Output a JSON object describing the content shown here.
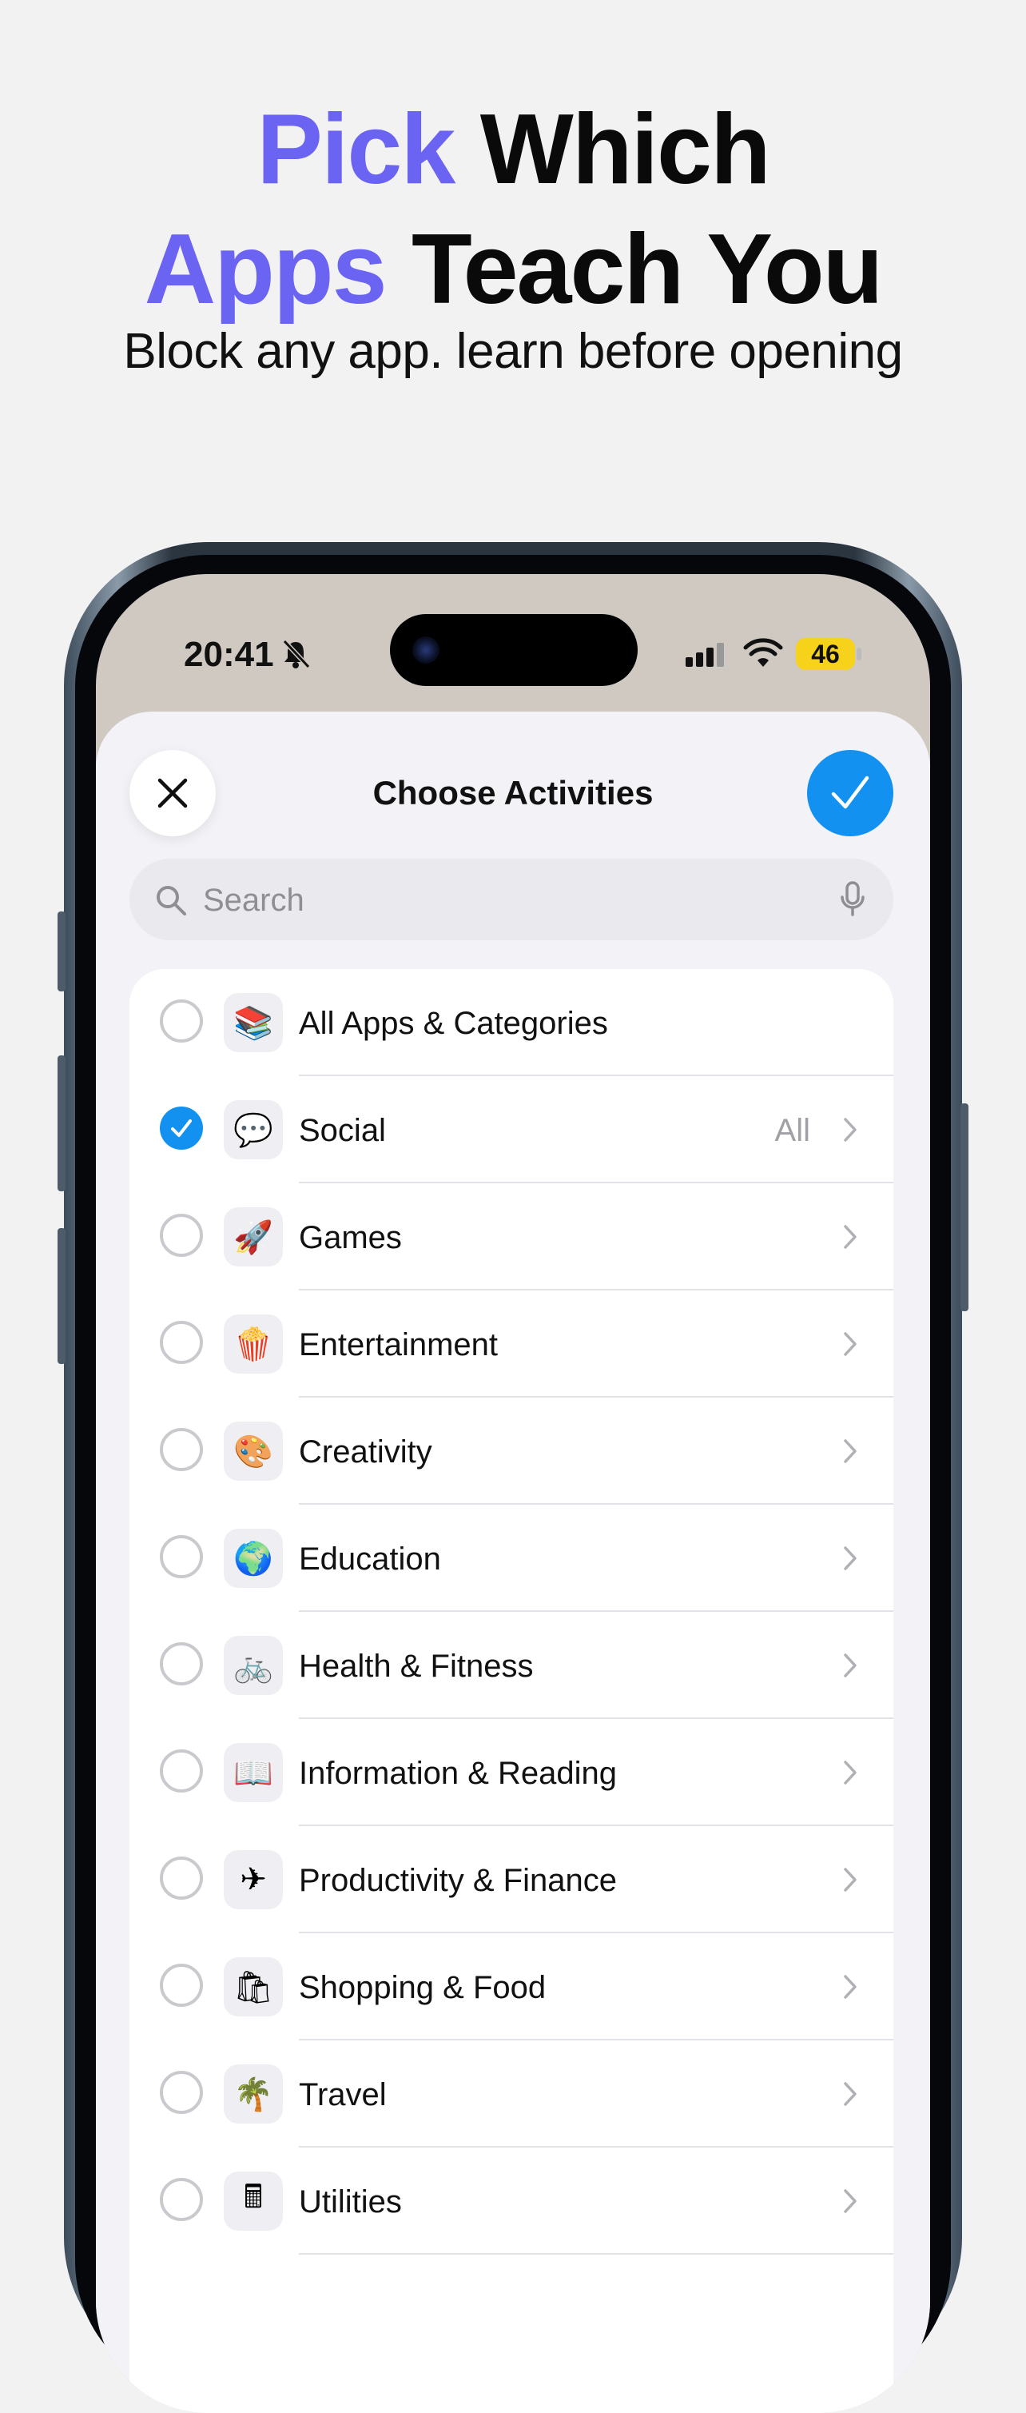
{
  "header": {
    "line1_accent": "Pick",
    "line1_rest": "Which",
    "line2_accent": "Apps",
    "line2_rest": "Teach You",
    "subtitle": "Block any app. learn before opening",
    "accent_color": "#6b63f2"
  },
  "status_bar": {
    "time": "20:41",
    "battery": "46",
    "icons": [
      "bell-slash-icon",
      "cellular-signal-icon",
      "wifi-icon",
      "battery-icon"
    ]
  },
  "sheet": {
    "title": "Choose Activities",
    "close_icon": "close-icon",
    "confirm_icon": "checkmark-icon",
    "confirm_color": "#1291f0",
    "search": {
      "placeholder": "Search",
      "value": ""
    }
  },
  "items": [
    {
      "label": "All Apps & Categories",
      "icon": "stack-icon",
      "checked": false,
      "detail": "",
      "chevron": false
    },
    {
      "label": "Social",
      "icon": "chat-bubbles-icon",
      "checked": true,
      "detail": "All",
      "chevron": true
    },
    {
      "label": "Games",
      "icon": "rocket-icon",
      "checked": false,
      "detail": "",
      "chevron": true
    },
    {
      "label": "Entertainment",
      "icon": "popcorn-icon",
      "checked": false,
      "detail": "",
      "chevron": true
    },
    {
      "label": "Creativity",
      "icon": "palette-icon",
      "checked": false,
      "detail": "",
      "chevron": true
    },
    {
      "label": "Education",
      "icon": "globe-icon",
      "checked": false,
      "detail": "",
      "chevron": true
    },
    {
      "label": "Health & Fitness",
      "icon": "bicycle-icon",
      "checked": false,
      "detail": "",
      "chevron": true
    },
    {
      "label": "Information & Reading",
      "icon": "book-icon",
      "checked": false,
      "detail": "",
      "chevron": true
    },
    {
      "label": "Productivity & Finance",
      "icon": "paper-plane-icon",
      "checked": false,
      "detail": "",
      "chevron": true
    },
    {
      "label": "Shopping & Food",
      "icon": "shopping-bag-icon",
      "checked": false,
      "detail": "",
      "chevron": true
    },
    {
      "label": "Travel",
      "icon": "palm-tree-icon",
      "checked": false,
      "detail": "",
      "chevron": true
    },
    {
      "label": "Utilities",
      "icon": "calculator-icon",
      "checked": false,
      "detail": "",
      "chevron": true
    }
  ]
}
